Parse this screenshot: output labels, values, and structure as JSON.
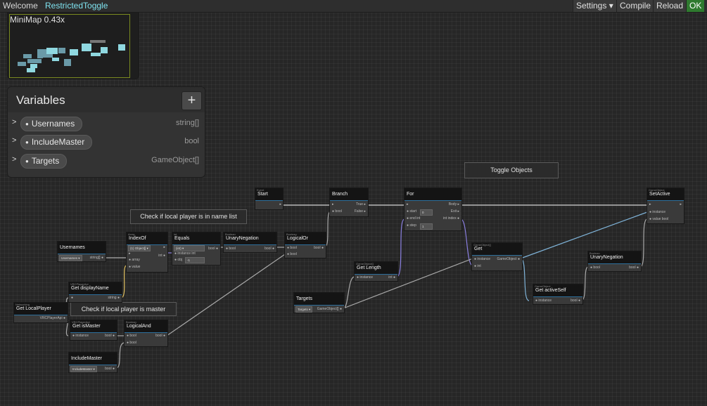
{
  "tabs": {
    "welcome": "Welcome",
    "current": "RestrictedToggle"
  },
  "toolbar": {
    "settings": "Settings ▾",
    "compile": "Compile",
    "reload": "Reload",
    "ok": "OK"
  },
  "minimap": {
    "label": "MiniMap  0.43x"
  },
  "variables": {
    "title": "Variables",
    "add": "+",
    "items": [
      {
        "name": "Usernames",
        "type": "string[]"
      },
      {
        "name": "IncludeMaster",
        "type": "bool"
      },
      {
        "name": "Targets",
        "type": "GameObject[]"
      }
    ]
  },
  "comments": {
    "toggle": "Toggle Objects",
    "name_list": "Check if local player is in name list",
    "master": "Check if local player is master"
  },
  "nodes": {
    "start": {
      "cat": "Event",
      "title": "Start"
    },
    "branch": {
      "title": "Branch",
      "bool": "bool",
      "true": "True",
      "false": "False"
    },
    "for": {
      "title": "For",
      "start": "start",
      "start_val": "0",
      "end": "end",
      "end_type": "int",
      "step": "step",
      "step_val": "1",
      "body": "Body",
      "exit": "Exit",
      "index": "int index"
    },
    "setactive": {
      "cat": "GameObject",
      "title": "SetActive",
      "instance": "instance",
      "value": "value bool"
    },
    "usernames": {
      "title": "Usernames",
      "var": "Usernames ▾",
      "out": "string[]"
    },
    "indexof": {
      "cat": "Array",
      "title": "IndexOf",
      "dd": "(1) Object[] ▾",
      "array": "array",
      "value": "value",
      "out": "int"
    },
    "equals": {
      "cat": "int",
      "title": "Equals",
      "dd": "(int) ▾",
      "instance": "instance int",
      "obj": "obj",
      "obj_val": "-1",
      "out": "bool"
    },
    "unary1": {
      "cat": "Boolean",
      "title": "UnaryNegation",
      "in": "bool",
      "out": "bool"
    },
    "logicalor": {
      "cat": "Boolean",
      "title": "LogicalOr",
      "in1": "bool",
      "in2": "bool",
      "out": "bool"
    },
    "getlength": {
      "cat": "GameObject[]",
      "title": "Get Length",
      "instance": "instance",
      "out": "int"
    },
    "targets": {
      "title": "Targets",
      "var": "Targets ▾",
      "out": "GameObject[]"
    },
    "get": {
      "cat": "GameObject[]",
      "title": "Get",
      "instance": "instance",
      "out": "GameObject",
      "index": "int"
    },
    "unary2": {
      "cat": "Boolean",
      "title": "UnaryNegation",
      "in": "bool",
      "out": "bool"
    },
    "getactiveself": {
      "cat": "GameObject",
      "title": "Get activeSelf",
      "instance": "instance",
      "out": "bool"
    },
    "getdisplayname": {
      "cat": "VRCPlayerApi",
      "title": "Get displayName",
      "out": "string"
    },
    "getlocalplayer": {
      "cat": "Networking",
      "title": "Get LocalPlayer",
      "out": "VRCPlayerApi"
    },
    "getismaster": {
      "cat": "VRCPlayerApi",
      "title": "Get isMaster",
      "instance": "instance",
      "out": "bool"
    },
    "logicaland": {
      "cat": "Boolean",
      "title": "LogicalAnd",
      "in1": "bool",
      "in2": "bool",
      "out": "bool"
    },
    "includemaster": {
      "title": "IncludeMaster",
      "var": "IncludeMaster ▾",
      "out": "bool"
    }
  },
  "colors": {
    "accent": "#7fe3f0",
    "ok": "#2f7a2f",
    "wire_flow": "#d0d0d0",
    "wire_int": "#8a7fe0",
    "wire_go": "#7fb3d8",
    "wire_bool": "#aaaaaa",
    "wire_string": "#e0c060"
  }
}
